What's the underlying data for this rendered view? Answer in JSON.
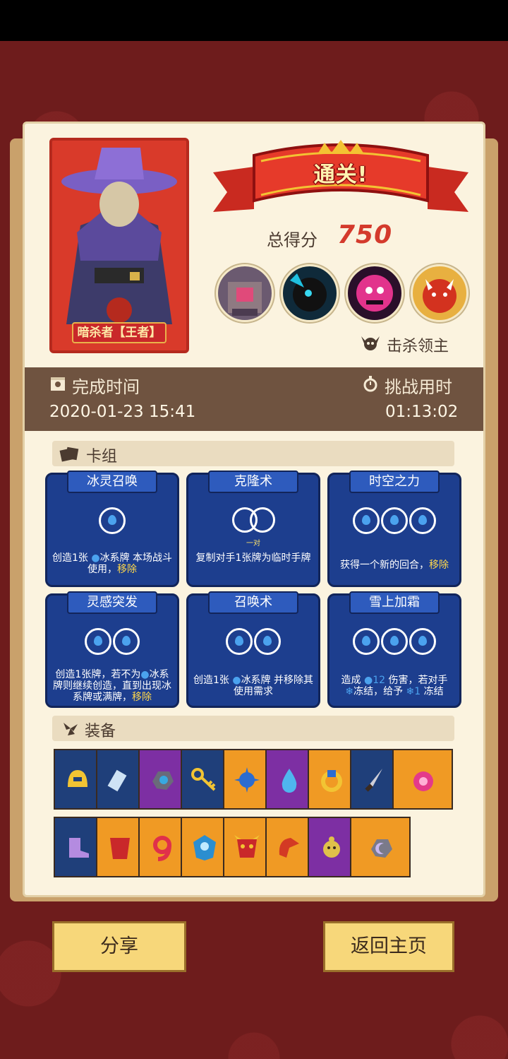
{
  "hero": {
    "name": "暗杀者【王者】"
  },
  "banner": {
    "title": "通关!"
  },
  "score": {
    "label": "总得分",
    "value": "750"
  },
  "bosses": {
    "label": "击杀领主",
    "icons": [
      "boss-1-portrait",
      "boss-2-portrait",
      "boss-3-portrait",
      "boss-4-portrait"
    ]
  },
  "time": {
    "finish_label": "完成时间",
    "finish_value": "2020-01-23 15:41",
    "duration_label": "挑战用时",
    "duration_value": "01:13:02"
  },
  "deck": {
    "title": "卡组",
    "cards": [
      {
        "name": "冰灵召唤",
        "desc_a": "创造1张",
        "desc_b": "冰系牌 本场战斗使用，",
        "desc_hl": "移除"
      },
      {
        "name": "克隆术",
        "pair": "一对",
        "desc": "复制对手1张牌为临时手牌"
      },
      {
        "name": "时空之力",
        "desc": "获得一个新的回合，",
        "desc_hl": "移除"
      },
      {
        "name": "灵感突发",
        "desc_a": "创造1张牌，若不为",
        "desc_b": "冰系牌则继续创造，直到出现冰系牌或满牌，",
        "desc_hl": "移除"
      },
      {
        "name": "召唤术",
        "desc_a": "创造1张",
        "desc_b": "冰系牌 并移除其使用需求"
      },
      {
        "name": "雪上加霜",
        "desc_a": "造成",
        "dmg": "12",
        "desc_b": "伤害，若对手",
        "desc_c": "冻结，给予",
        "freeze": "1",
        "desc_d": "冻结"
      }
    ]
  },
  "equipment": {
    "title": "装备",
    "row1": [
      "blue",
      "blue",
      "purple",
      "blue",
      "blue",
      "orange",
      "purple",
      "orange",
      "blue",
      "orange"
    ],
    "row2": [
      "blue",
      "orange",
      "orange",
      "orange",
      "orange",
      "orange",
      "orange",
      "purple",
      "orange"
    ]
  },
  "buttons": {
    "share": "分享",
    "home": "返回主页"
  }
}
